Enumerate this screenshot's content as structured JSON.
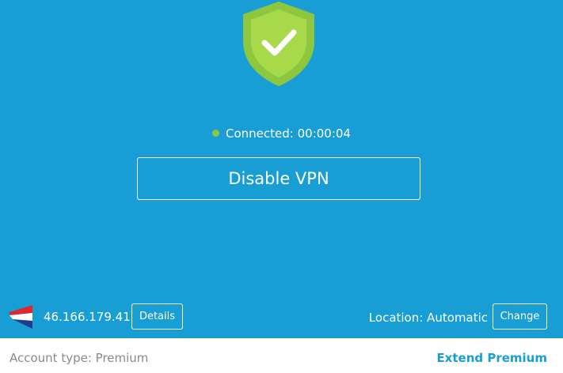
{
  "colors": {
    "background": "#189ed5",
    "shield": "#8dc63f",
    "shield_inner": "#a8d94a",
    "status_dot": "#8dc63f",
    "footer": "#ffffff",
    "link": "#189ed5"
  },
  "status": {
    "icon": "shield-check-icon",
    "text": "Connected: 00:00:04"
  },
  "main_button": {
    "label": "Disable VPN"
  },
  "connection": {
    "flag_icon": "netherlands-flag-icon",
    "ip_address": "46.166.179.41",
    "details_label": "Details",
    "location_text": "Location: Automatic",
    "change_label": "Change"
  },
  "footer": {
    "account_type": "Account type: Premium",
    "extend_label": "Extend Premium"
  }
}
